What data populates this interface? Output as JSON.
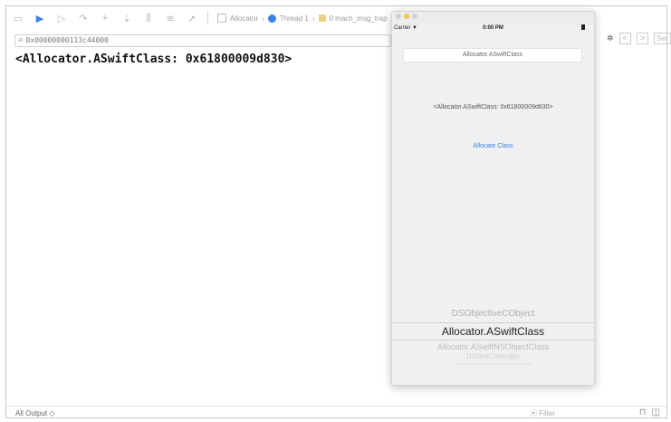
{
  "toolbar": {
    "icons": [
      "sidebar-icon",
      "breakpoint-icon",
      "continue-icon",
      "step-over-icon",
      "step-in-icon",
      "step-out-icon",
      "debug-view-icon",
      "memory-icon",
      "location-icon"
    ],
    "crumbs": [
      "Allocator",
      "Thread 1",
      "0 mach_msg_trap"
    ]
  },
  "address": {
    "value": "0x00000000113c44000"
  },
  "output": {
    "text": "<Allocator.ASwiftClass: 0x61800009d830>"
  },
  "right_controls": {
    "nav_back": "<",
    "nav_fwd": ">",
    "search_text": "Ser"
  },
  "bottom": {
    "left_label": "All Output ◇",
    "filter_label": "Filter"
  },
  "simulator": {
    "status": {
      "carrier": "Carrier ▼",
      "time": "0:00 PM"
    },
    "text_field": "Allocator.ASwiftClass",
    "description": "<Allocator.ASwiftClass: 0x61800009d830>",
    "button": "Allocate Class",
    "picker": {
      "above": "DSObjectiveCObject",
      "selected": "Allocator.ASwiftClass",
      "below1": "Allocator.ASwiftNSObjectClass",
      "below2": "UIAlertController",
      "below3": "UIAlertControllerVisualStyleAlertActionViewRow"
    }
  }
}
